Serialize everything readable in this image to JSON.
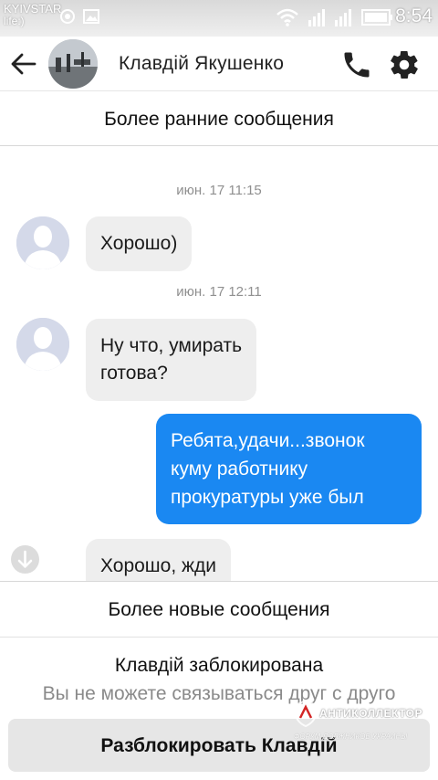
{
  "status_bar": {
    "carrier": "KYIVSTAR",
    "carrier_sub": "life:)",
    "time": "8:54"
  },
  "header": {
    "contact_name": "Клавдій Якушенко"
  },
  "load_earlier_label": "Более ранние сообщения",
  "messages": [
    {
      "timestamp": "июн. 17 11:15",
      "direction": "incoming",
      "text": "Хорошо)"
    },
    {
      "timestamp": "июн. 17 12:11",
      "direction": "incoming",
      "text_lines": [
        "Ну что, умирать",
        "готова?"
      ]
    },
    {
      "direction": "outgoing",
      "text_lines": [
        "Ребята,удачи...звонок",
        "куму работнику",
        "прокуратуры уже был"
      ]
    },
    {
      "direction": "incoming",
      "text": "Хорошо, жди"
    }
  ],
  "load_newer_label": "Более новые сообщения",
  "blocked": {
    "title": "Клавдій заблокирована",
    "description": "Вы не можете связываться друг с друго",
    "unblock_label": "Разблокировать Клавдій"
  },
  "watermark": {
    "title": "АНТИКОЛЛЕКТОР",
    "subtitle": "ФОРУМ ДОЛЖНИКОВ УКРАИНЫ"
  },
  "colors": {
    "outgoing_bubble": "#1a88f2",
    "incoming_bubble": "#eeeeee"
  }
}
